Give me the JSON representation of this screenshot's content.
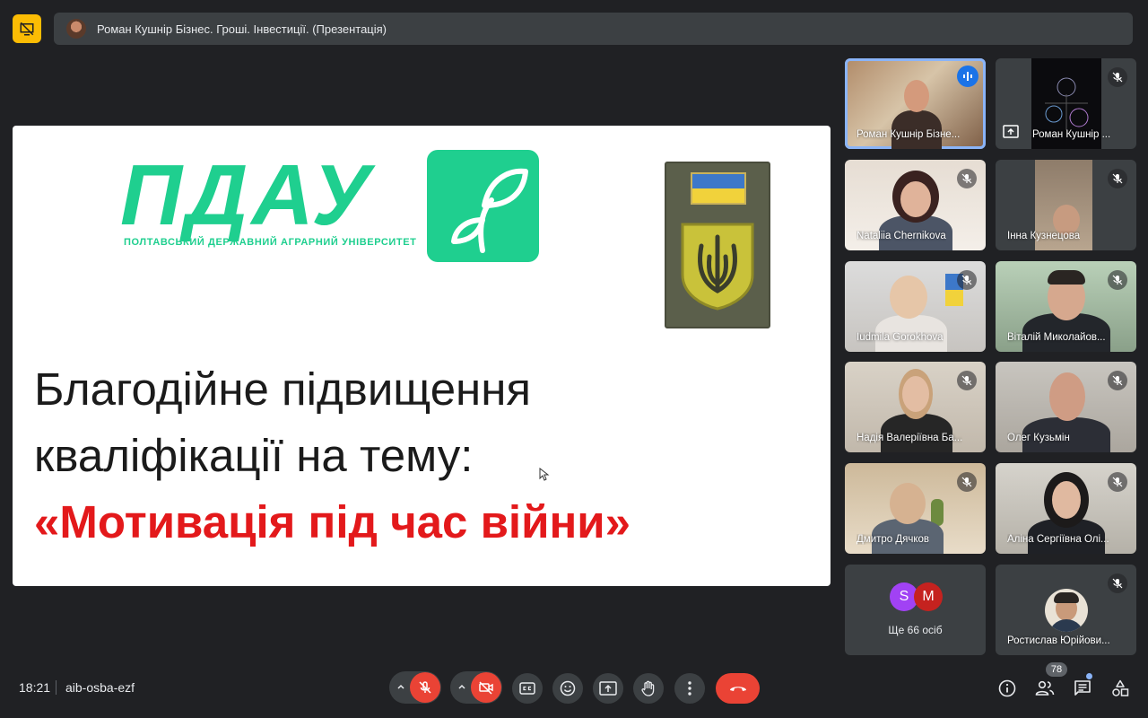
{
  "header": {
    "presentation_title": "Роман Кушнір Бізнес. Гроші. Інвестиції. (Презентація)"
  },
  "slide": {
    "logo_text": "ПДАУ",
    "logo_subtitle": "ПОЛТАВСЬКИЙ ДЕРЖАВНИЙ АГРАРНИЙ УНІВЕРСИТЕТ",
    "line1": "Благодійне підвищення",
    "line2": "кваліфікації на тему:",
    "accent_line": "«Мотивація під час війни»",
    "accent_color": "#e3191b",
    "logo_color": "#1fcf8f"
  },
  "participants": [
    {
      "name": "Роман Кушнір Бізне...",
      "state": "speaking"
    },
    {
      "name": "Роман Кушнір ...",
      "state": "muted",
      "presenting": true
    },
    {
      "name": "Nataliia Chernikova",
      "state": "muted"
    },
    {
      "name": "Інна Кузнецова",
      "state": "muted"
    },
    {
      "name": "Iudmila Gorokhova",
      "state": "muted"
    },
    {
      "name": "Віталій Миколайов...",
      "state": "muted"
    },
    {
      "name": "Надія Валеріївна Ба...",
      "state": "muted"
    },
    {
      "name": "Олег Кузьмін",
      "state": "muted"
    },
    {
      "name": "Дмитро Дячков",
      "state": "muted"
    },
    {
      "name": "Аліна Сергіївна Олі...",
      "state": "muted"
    },
    {
      "name": "Ростислав Юрійови...",
      "state": "muted"
    }
  ],
  "others": {
    "avatars": [
      {
        "letter": "S",
        "color": "#a142f4"
      },
      {
        "letter": "M",
        "color": "#c5221f"
      }
    ],
    "label": "Ще 66 осіб"
  },
  "footer": {
    "time": "18:21",
    "meeting_code": "aib-osba-ezf",
    "participant_count": "78"
  },
  "icons": [
    "presentation-off-icon",
    "mic-off-icon",
    "camera-off-icon",
    "captions-icon",
    "emoji-icon",
    "present-icon",
    "raise-hand-icon",
    "more-options-icon",
    "hang-up-icon",
    "info-icon",
    "people-icon",
    "chat-icon",
    "activities-icon"
  ],
  "colors": {
    "background": "#202124",
    "control": "#3c4043",
    "danger": "#ea4335",
    "accent_blue": "#8ab4f8",
    "warning": "#fbbc04"
  }
}
